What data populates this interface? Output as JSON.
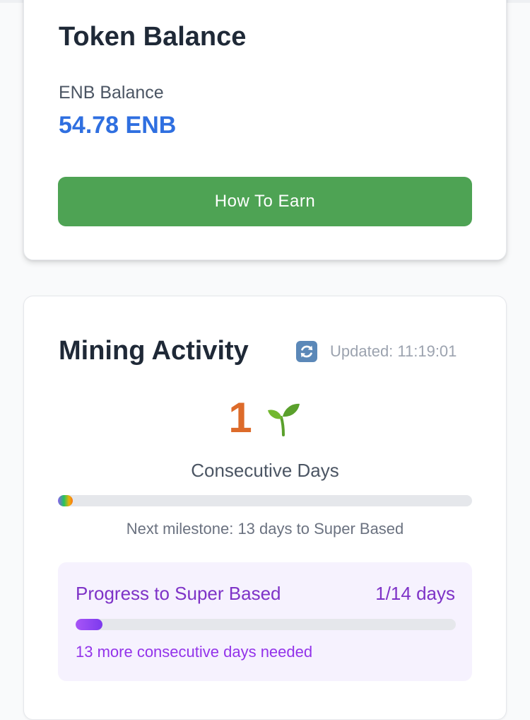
{
  "token_balance": {
    "title": "Token Balance",
    "label": "ENB Balance",
    "value": "54.78 ENB",
    "earn_button_label": "How To Earn",
    "accent_color": "#2f6fe0",
    "button_color": "#4ea354"
  },
  "mining_activity": {
    "title": "Mining Activity",
    "refresh_icon": "refresh-icon",
    "updated_text": "Updated: 11:19:01",
    "streak_number": "1",
    "streak_icon": "sprout-icon",
    "streak_label": "Consecutive Days",
    "streak_progress_fraction": 0.035,
    "milestone_text": "Next milestone: 13 days to Super Based",
    "progress_panel": {
      "title": "Progress to Super Based",
      "count": "1/14 days",
      "progress_fraction": 0.071,
      "needed_text": "13 more consecutive days needed"
    },
    "streak_color": "#dd6b2a",
    "panel_accent_color": "#7e33c7"
  }
}
